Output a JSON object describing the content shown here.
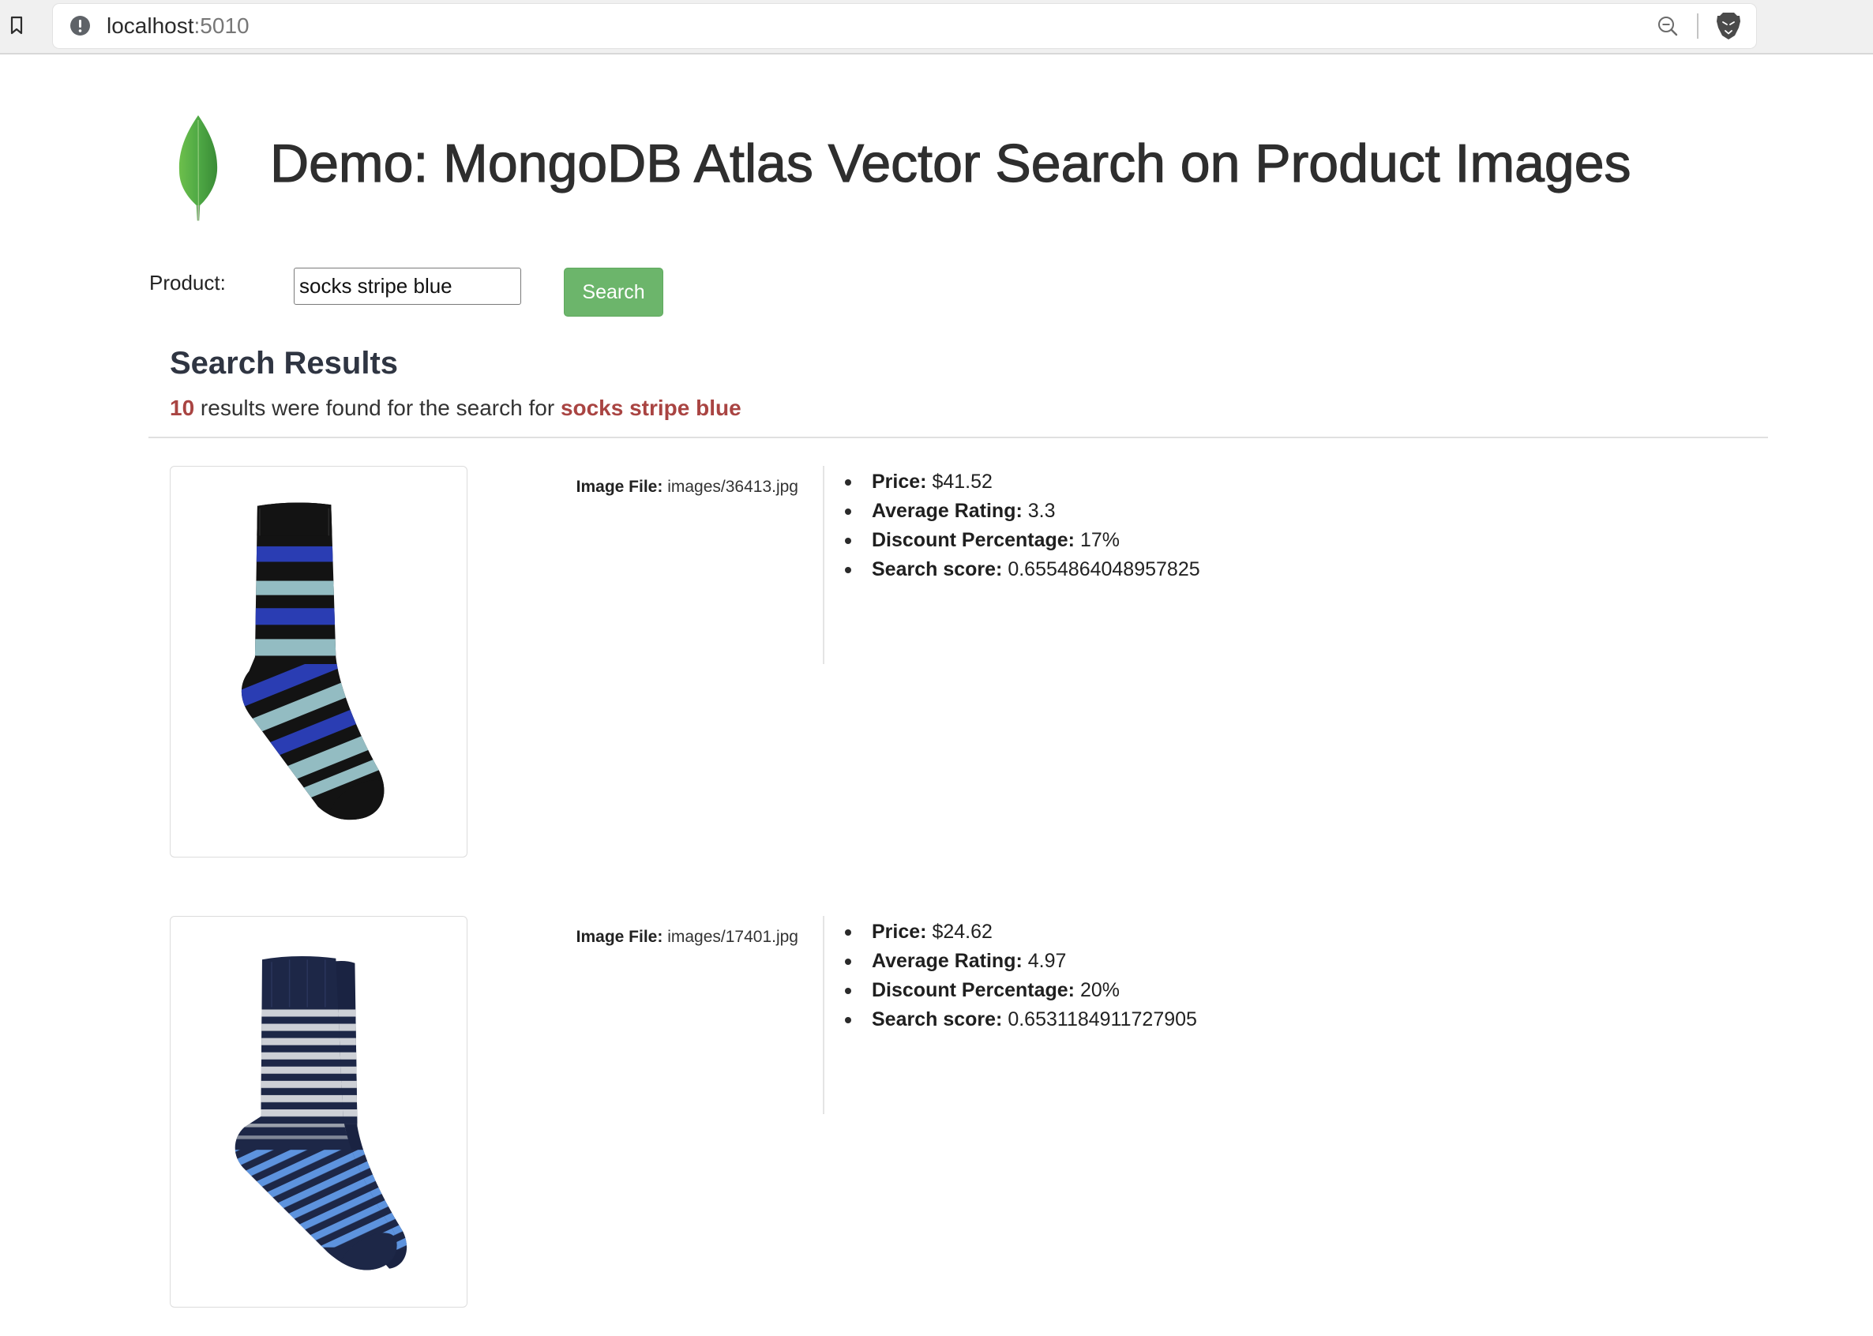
{
  "browser": {
    "url_host": "localhost",
    "url_port": ":5010",
    "icons": {
      "bookmark": "bookmark-icon",
      "site_info": "info-icon",
      "zoom": "zoom-out-icon",
      "brave_shields": "brave-lion-icon"
    }
  },
  "header": {
    "logo_icon": "mongodb-leaf-icon",
    "title": "Demo: MongoDB Atlas Vector Search on Product Images"
  },
  "search_form": {
    "label": "Product:",
    "input_value": "socks stripe blue",
    "button_label": "Search"
  },
  "results": {
    "heading": "Search Results",
    "count": "10",
    "summary_text": " results were found for the search for ",
    "query": "socks stripe blue",
    "items": [
      {
        "image_icon": "striped-sock-black-blue-photo",
        "image_file_label": "Image File:",
        "image_file": "images/36413.jpg",
        "details": [
          {
            "label": "Price:",
            "value": "$41.52"
          },
          {
            "label": "Average Rating:",
            "value": "3.3"
          },
          {
            "label": "Discount Percentage:",
            "value": "17%"
          },
          {
            "label": "Search score:",
            "value": "0.6554864048957825"
          }
        ]
      },
      {
        "image_icon": "striped-sock-navy-gray-blue-photo",
        "image_file_label": "Image File:",
        "image_file": "images/17401.jpg",
        "details": [
          {
            "label": "Price:",
            "value": "$24.62"
          },
          {
            "label": "Average Rating:",
            "value": "4.97"
          },
          {
            "label": "Discount Percentage:",
            "value": "20%"
          },
          {
            "label": "Search score:",
            "value": "0.6531184911727905"
          }
        ]
      }
    ]
  },
  "colors": {
    "button_green": "#6cb56b",
    "highlight_red": "#a94442",
    "heading_text": "#2f3542",
    "body_text": "#333333"
  }
}
